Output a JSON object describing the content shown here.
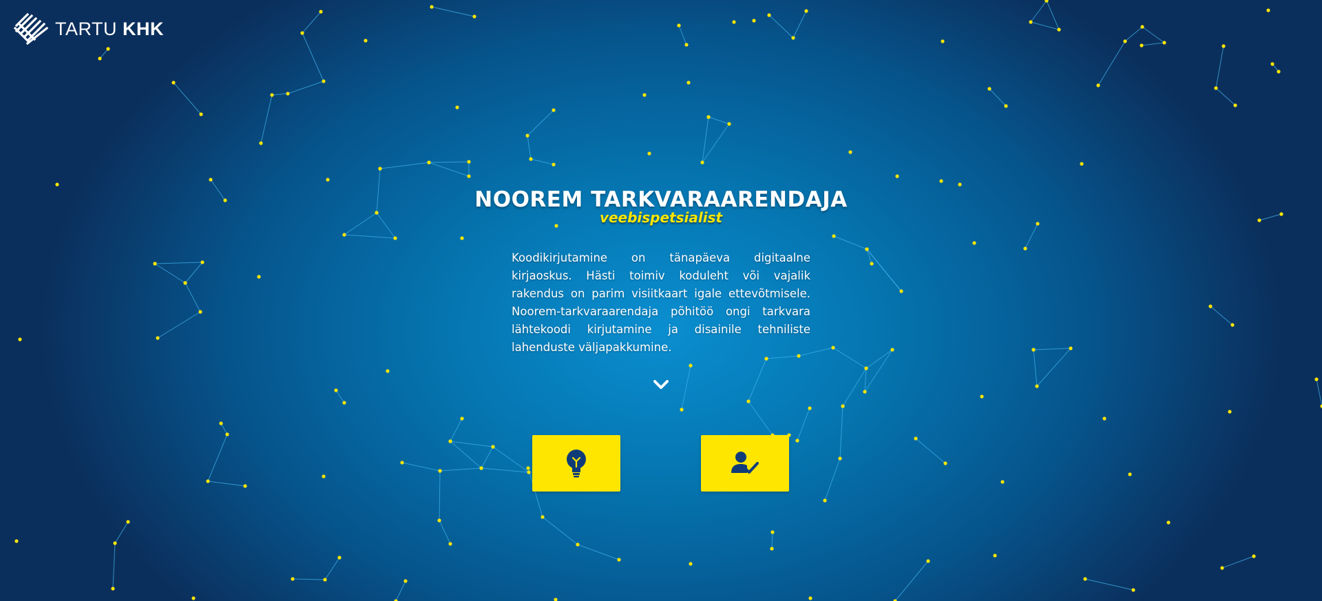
{
  "brand": {
    "name_light": "TARTU",
    "name_bold": "KHK",
    "logo_icon": "khk-logo-icon"
  },
  "hero": {
    "title": "NOOREM TARKVARAARENDAJA",
    "subtitle": "veebispetsialist",
    "description": "Koodikirjutamine on tänapäeva digitaalne kirjaoskus. Hästi toimiv koduleht või vajalik rakendus on parim visiitkaart igale ettevõtmisele. Noorem-tarkvaraarendaja põhitöö ongi tarkvara lähtekoodi kirjutamine ja disainile tehniliste lahenduste väljapakkumine."
  },
  "actions": [
    {
      "icon": "lightbulb-icon"
    },
    {
      "icon": "person-check-icon"
    }
  ],
  "scroll": {
    "icon": "chevron-down-icon"
  },
  "colors": {
    "background_center": "#0a8ed0",
    "background_edge": "#0b2f5c",
    "accent": "#ffe600",
    "icon_dark": "#0f3c78",
    "constellation_line": "#3fb0e8"
  }
}
